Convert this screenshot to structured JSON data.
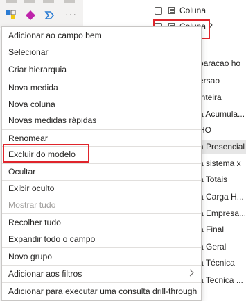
{
  "fields": {
    "items": [
      {
        "label": "Coluna",
        "checkbox": true,
        "icon": "table-column-icon"
      },
      {
        "label": "Coluna 2",
        "checkbox": true,
        "icon": "table-column-icon"
      }
    ],
    "partial_items": [
      "paracao ho",
      "ersao",
      "inteira",
      "a Acumula...",
      "HO",
      "a Presencial",
      "a sistema x",
      "a Totais",
      "a Carga H...",
      "a Empresa...",
      "a Final",
      "a Geral",
      "a Técnica",
      "a Tecnica ..."
    ]
  },
  "context_menu": {
    "items": [
      {
        "label": "Adicionar ao campo bem",
        "enabled": true
      },
      {
        "label": "Selecionar",
        "enabled": true
      },
      {
        "label": "Criar hierarquia",
        "enabled": true
      },
      {
        "label": "Nova medida",
        "enabled": true
      },
      {
        "label": "Nova coluna",
        "enabled": true
      },
      {
        "label": "Novas medidas rápidas",
        "enabled": true
      },
      {
        "label": "Renomear",
        "enabled": true
      },
      {
        "label": "Excluir do modelo",
        "enabled": true,
        "highlighted": true
      },
      {
        "label": "Ocultar",
        "enabled": true
      },
      {
        "label": "Exibir oculto",
        "enabled": true
      },
      {
        "label": "Mostrar tudo",
        "enabled": false
      },
      {
        "label": "Recolher tudo",
        "enabled": true
      },
      {
        "label": "Expandir todo o campo",
        "enabled": true
      },
      {
        "label": "Novo grupo",
        "enabled": true
      },
      {
        "label": "Adicionar aos filtros",
        "enabled": true,
        "submenu": true
      },
      {
        "label": "Adicionar para executar uma consulta drill-through",
        "enabled": true
      }
    ]
  },
  "viz_pane": {
    "icons": [
      "python-visual-icon",
      "key-influencers-icon",
      "decomposition-tree-icon",
      "more-visuals-icon"
    ]
  },
  "colors": {
    "highlight": "#e0242b",
    "accent": "#2b7cd3",
    "disabled_text": "#a19f9d"
  }
}
